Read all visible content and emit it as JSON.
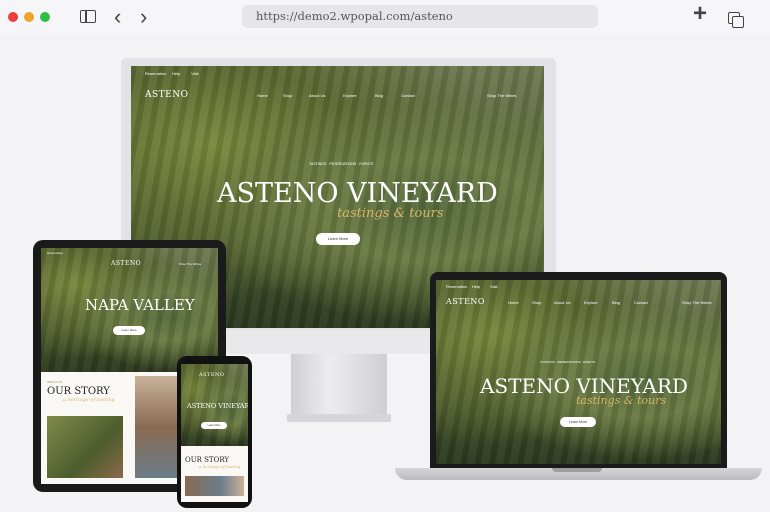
{
  "browser": {
    "url": "https://demo2.wpopal.com/asteno",
    "icons": [
      "sidebar-toggle-icon",
      "back-arrow-icon",
      "forward-arrow-icon",
      "new-tab-plus-icon",
      "duplicate-tabs-icon"
    ]
  },
  "site": {
    "logo": "ASTENO",
    "topbar": [
      "Reservation",
      "Help",
      "Visit"
    ],
    "nav": [
      "Home",
      "Shop",
      "About Us",
      "Explore",
      "Blog",
      "Contact"
    ],
    "shop_label": "Shop The Wines",
    "kicker": "TASTINGS · RESERVATIONS · EVENTS",
    "hero_title": "ASTENO VINEYARD",
    "hero_script": "tastings & tours",
    "button": "Learn More",
    "tablet_title": "NAPA VALLEY",
    "story_title": "OUR STORY",
    "story_script": "a heritage of tasting",
    "story_kicker": "ABOUT US"
  },
  "colors": {
    "accent_gold": "#d7b46a",
    "chrome_bg": "#f6f6f8",
    "device_frame": "#1b1b1b"
  }
}
